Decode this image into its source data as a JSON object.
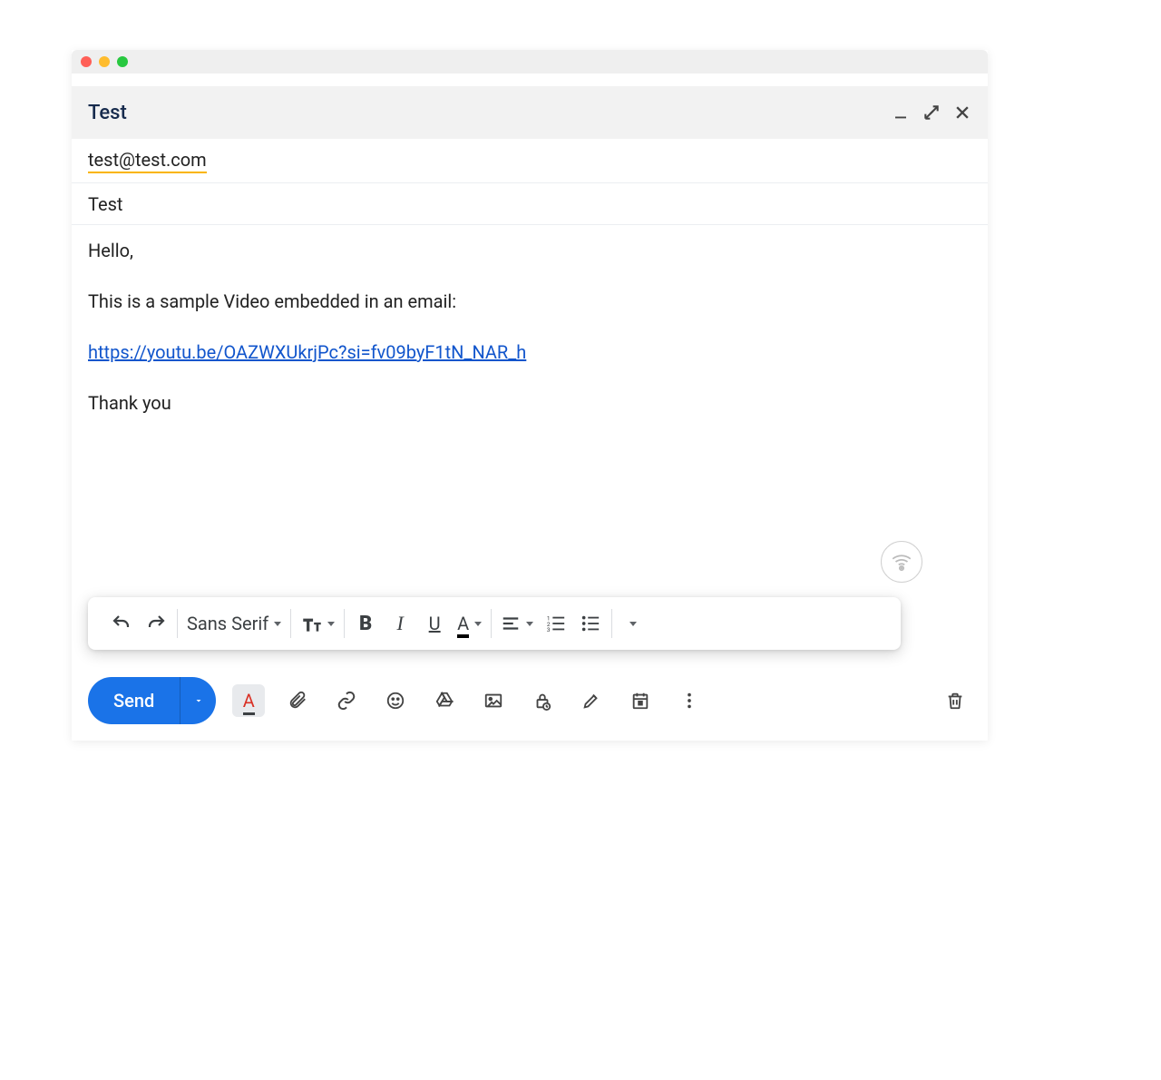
{
  "compose": {
    "title": "Test",
    "to": "test@test.com",
    "subject": "Test",
    "body": {
      "greeting": "Hello,",
      "intro": "This is a sample Video embedded in an email:",
      "link": "https://youtu.be/OAZWXUkrjPc?si=fv09byF1tN_NAR_h",
      "closing": "Thank you"
    }
  },
  "format_toolbar": {
    "font": "Sans Serif"
  },
  "actions": {
    "send_label": "Send"
  },
  "colors": {
    "accent": "#1a73e8",
    "link": "#1155cc",
    "to_underline": "#fab500"
  }
}
